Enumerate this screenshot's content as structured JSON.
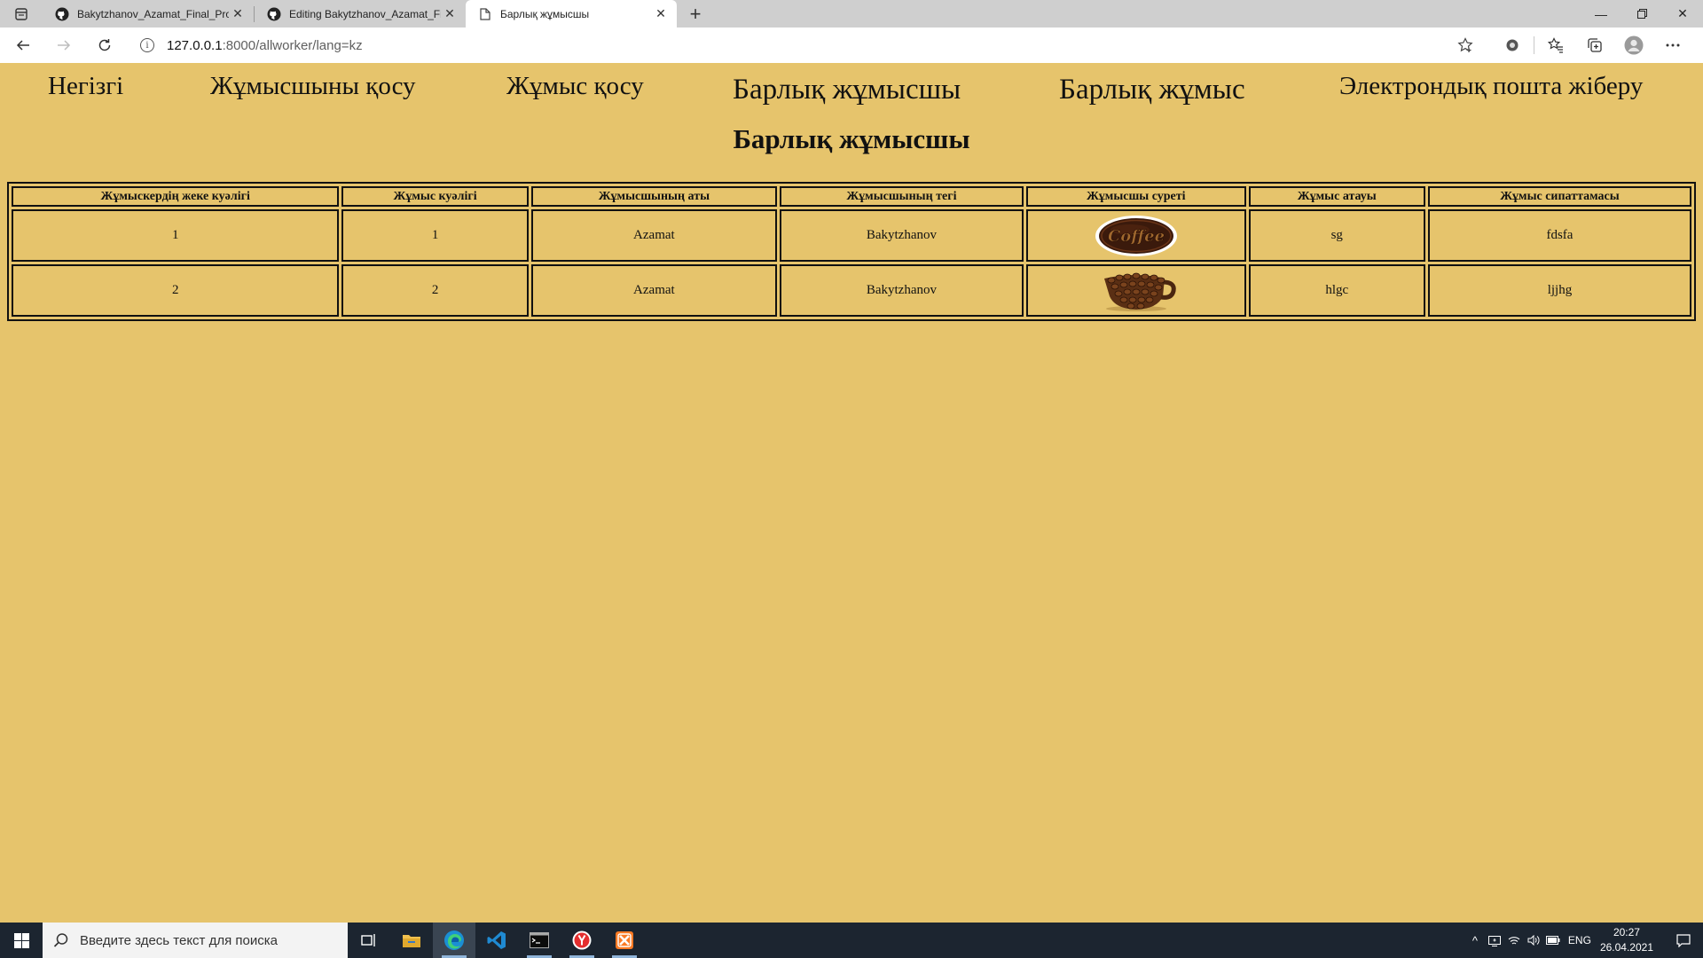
{
  "browser": {
    "tabs": [
      {
        "title": "Bakytzhanov_Azamat_Final_Proje",
        "favicon": "github-icon",
        "active": false
      },
      {
        "title": "Editing Bakytzhanov_Azamat_Fin",
        "favicon": "github-icon",
        "active": false
      },
      {
        "title": "Барлық жұмысшы",
        "favicon": "page-icon",
        "active": true
      }
    ],
    "address": {
      "host": "127.0.0.1",
      "path": ":8000/allworker/lang=kz"
    }
  },
  "nav": {
    "home": "Негізгі",
    "add_worker": "Жұмысшыны қосу",
    "add_job": "Жұмыс қосу",
    "all_workers": "Барлық жұмысшы",
    "all_jobs": "Барлық жұмыс",
    "send_email": "Электрондық пошта жіберу"
  },
  "page": {
    "heading": "Барлық жұмысшы"
  },
  "table": {
    "headers": [
      "Жұмыскердің жеке куәлігі",
      "Жұмыс куәлігі",
      "Жұмысшының аты",
      "Жұмысшының тегі",
      "Жұмысшы суреті",
      "Жұмыс атауы",
      "Жұмыс сипаттамасы"
    ],
    "rows": [
      {
        "worker_id": "1",
        "job_id": "1",
        "first_name": "Azamat",
        "last_name": "Bakytzhanov",
        "photo": "coffee-logo-image",
        "photo_text": "Coffee",
        "job_title": "sg",
        "job_description": "fdsfa"
      },
      {
        "worker_id": "2",
        "job_id": "2",
        "first_name": "Azamat",
        "last_name": "Bakytzhanov",
        "photo": "coffee-beans-cup-image",
        "job_title": "hlgc",
        "job_description": "ljjhg"
      }
    ]
  },
  "taskbar": {
    "search_placeholder": "Введите здесь текст для поиска",
    "language": "ENG",
    "time": "20:27",
    "date": "26.04.2021"
  },
  "colors": {
    "page_background": "#e6c46c",
    "taskbar": "#1c2530"
  }
}
